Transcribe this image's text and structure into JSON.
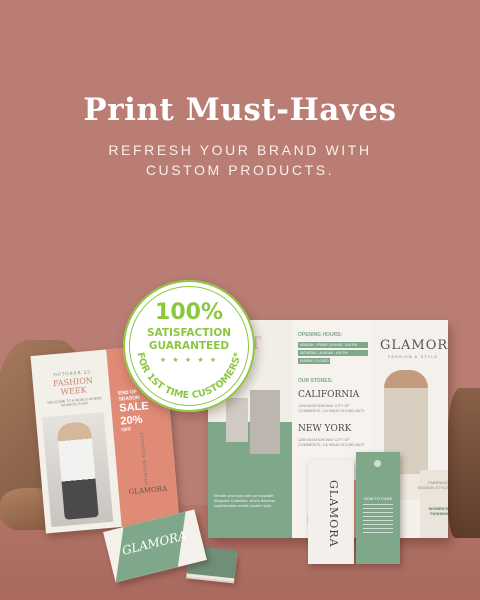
{
  "hero": {
    "title": "Print Must-Haves",
    "subtitle": "REFRESH YOUR BRAND WITH CUSTOM PRODUCTS."
  },
  "badge": {
    "percent": "100%",
    "line1": "SATISFACTION",
    "line2": "GUARANTEED",
    "stars": "★ ★ ★ ★ ★",
    "arc_text": "FOR 1ST TIME CUSTOMERS*"
  },
  "left_brochure": {
    "date": "OCTOBER 23",
    "headline": "FASHION WEEK",
    "body": "WELCOME TO A WORLD WHERE FASHION IS ART",
    "sale_line1": "END OF",
    "sale_line2": "SEASON",
    "sale_line3": "SALE",
    "sale_discount": "20%",
    "sale_off": "OFF",
    "vertical": "UNVEILING ELEGANCE",
    "logo": "GLAMORA"
  },
  "trifold": {
    "big_letter": "T",
    "hours_title": "OPENING HOURS:",
    "hours": [
      "MONDAY - FRIDAY | 9:00 AM - 6:00 PM",
      "SATURDAY | 10:00 AM - 4:00 PM",
      "SUNDAY | CLOSED"
    ],
    "stores_title": "OUR STORES:",
    "stores": [
      {
        "city": "CALIFORNIA",
        "address": "1290 AVIATION WAY CITY OF COMMERCE, CA 90040 213-952-5673"
      },
      {
        "city": "NEW YORK",
        "address": "1290 AVIATION WAY CITY OF COMMERCE, CA 90040 213-952-5673"
      }
    ],
    "panel1_text": "Elevate your look with our exquisite Elegance Collection, where timeless sophistication meets modern style.",
    "logo": "GLAMORA",
    "tagline": "FASHION & STYLE",
    "side_text1": "EMBRACE SEASON STYLE",
    "womens": "WOMEN'S FASHION"
  },
  "hang_tags": {
    "white_logo": "GLAMORA",
    "green_title": "HOW TO CARE"
  },
  "business_card": {
    "logo": "GLAMORA"
  },
  "colors": {
    "background": "#b97d74",
    "accent_green": "#8dc63f",
    "brand_green": "#7fa78a",
    "coral": "#e08b76"
  }
}
